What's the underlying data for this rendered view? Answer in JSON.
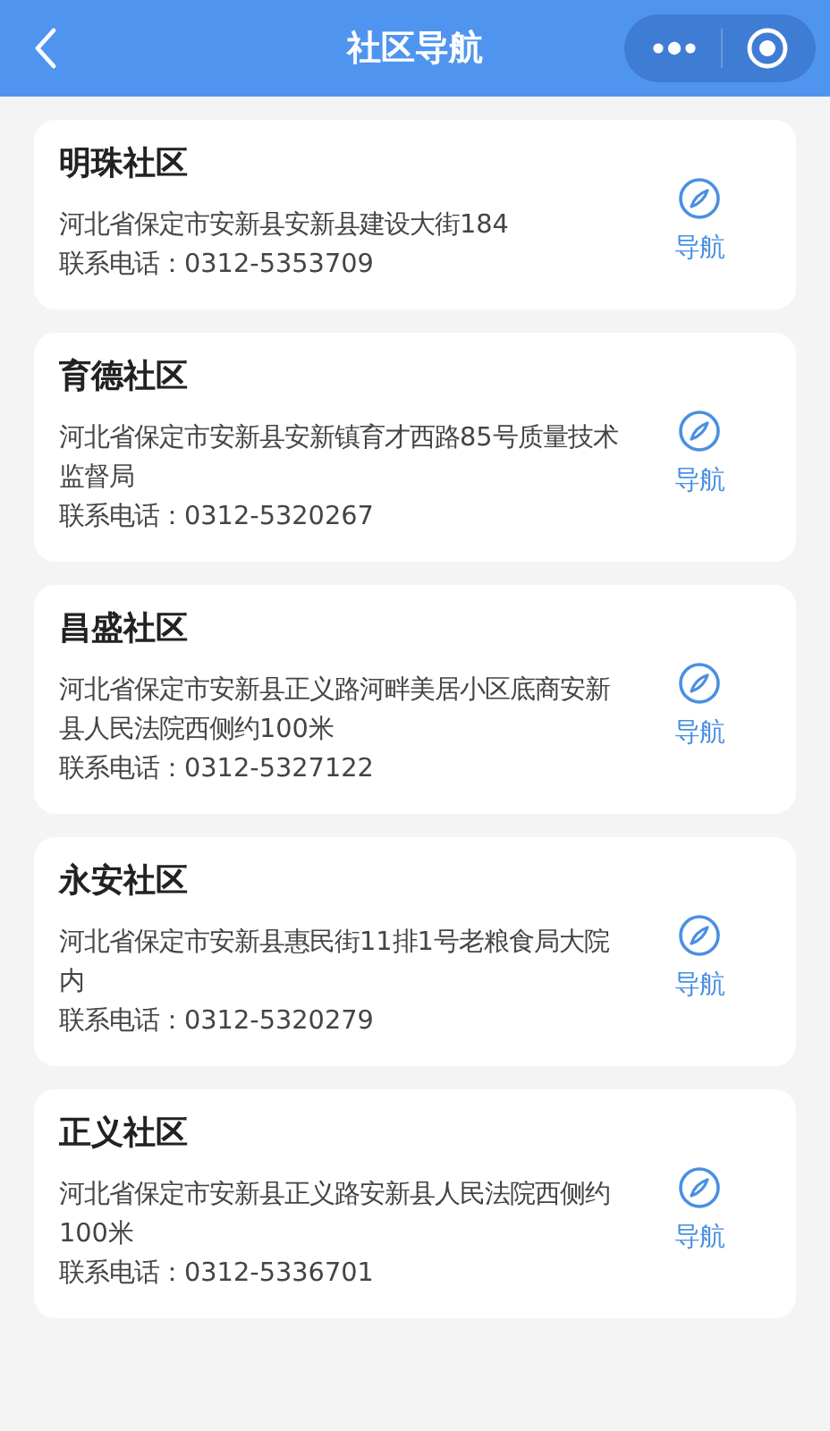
{
  "header": {
    "title": "社区导航"
  },
  "communities": [
    {
      "name": "明珠社区",
      "address": "河北省保定市安新县安新县建设大街184",
      "phone": "联系电话：0312-5353709",
      "nav_label": "导航"
    },
    {
      "name": "育德社区",
      "address": "河北省保定市安新县安新镇育才西路85号质量技术监督局",
      "phone": "联系电话：0312-5320267",
      "nav_label": "导航"
    },
    {
      "name": "昌盛社区",
      "address": "河北省保定市安新县正义路河畔美居小区底商安新县人民法院西侧约100米",
      "phone": "联系电话：0312-5327122",
      "nav_label": "导航"
    },
    {
      "name": "永安社区",
      "address": "河北省保定市安新县惠民街11排1号老粮食局大院内",
      "phone": "联系电话：0312-5320279",
      "nav_label": "导航"
    },
    {
      "name": "正义社区",
      "address": "河北省保定市安新县正义路安新县人民法院西侧约100米",
      "phone": "联系电话：0312-5336701",
      "nav_label": "导航"
    }
  ]
}
